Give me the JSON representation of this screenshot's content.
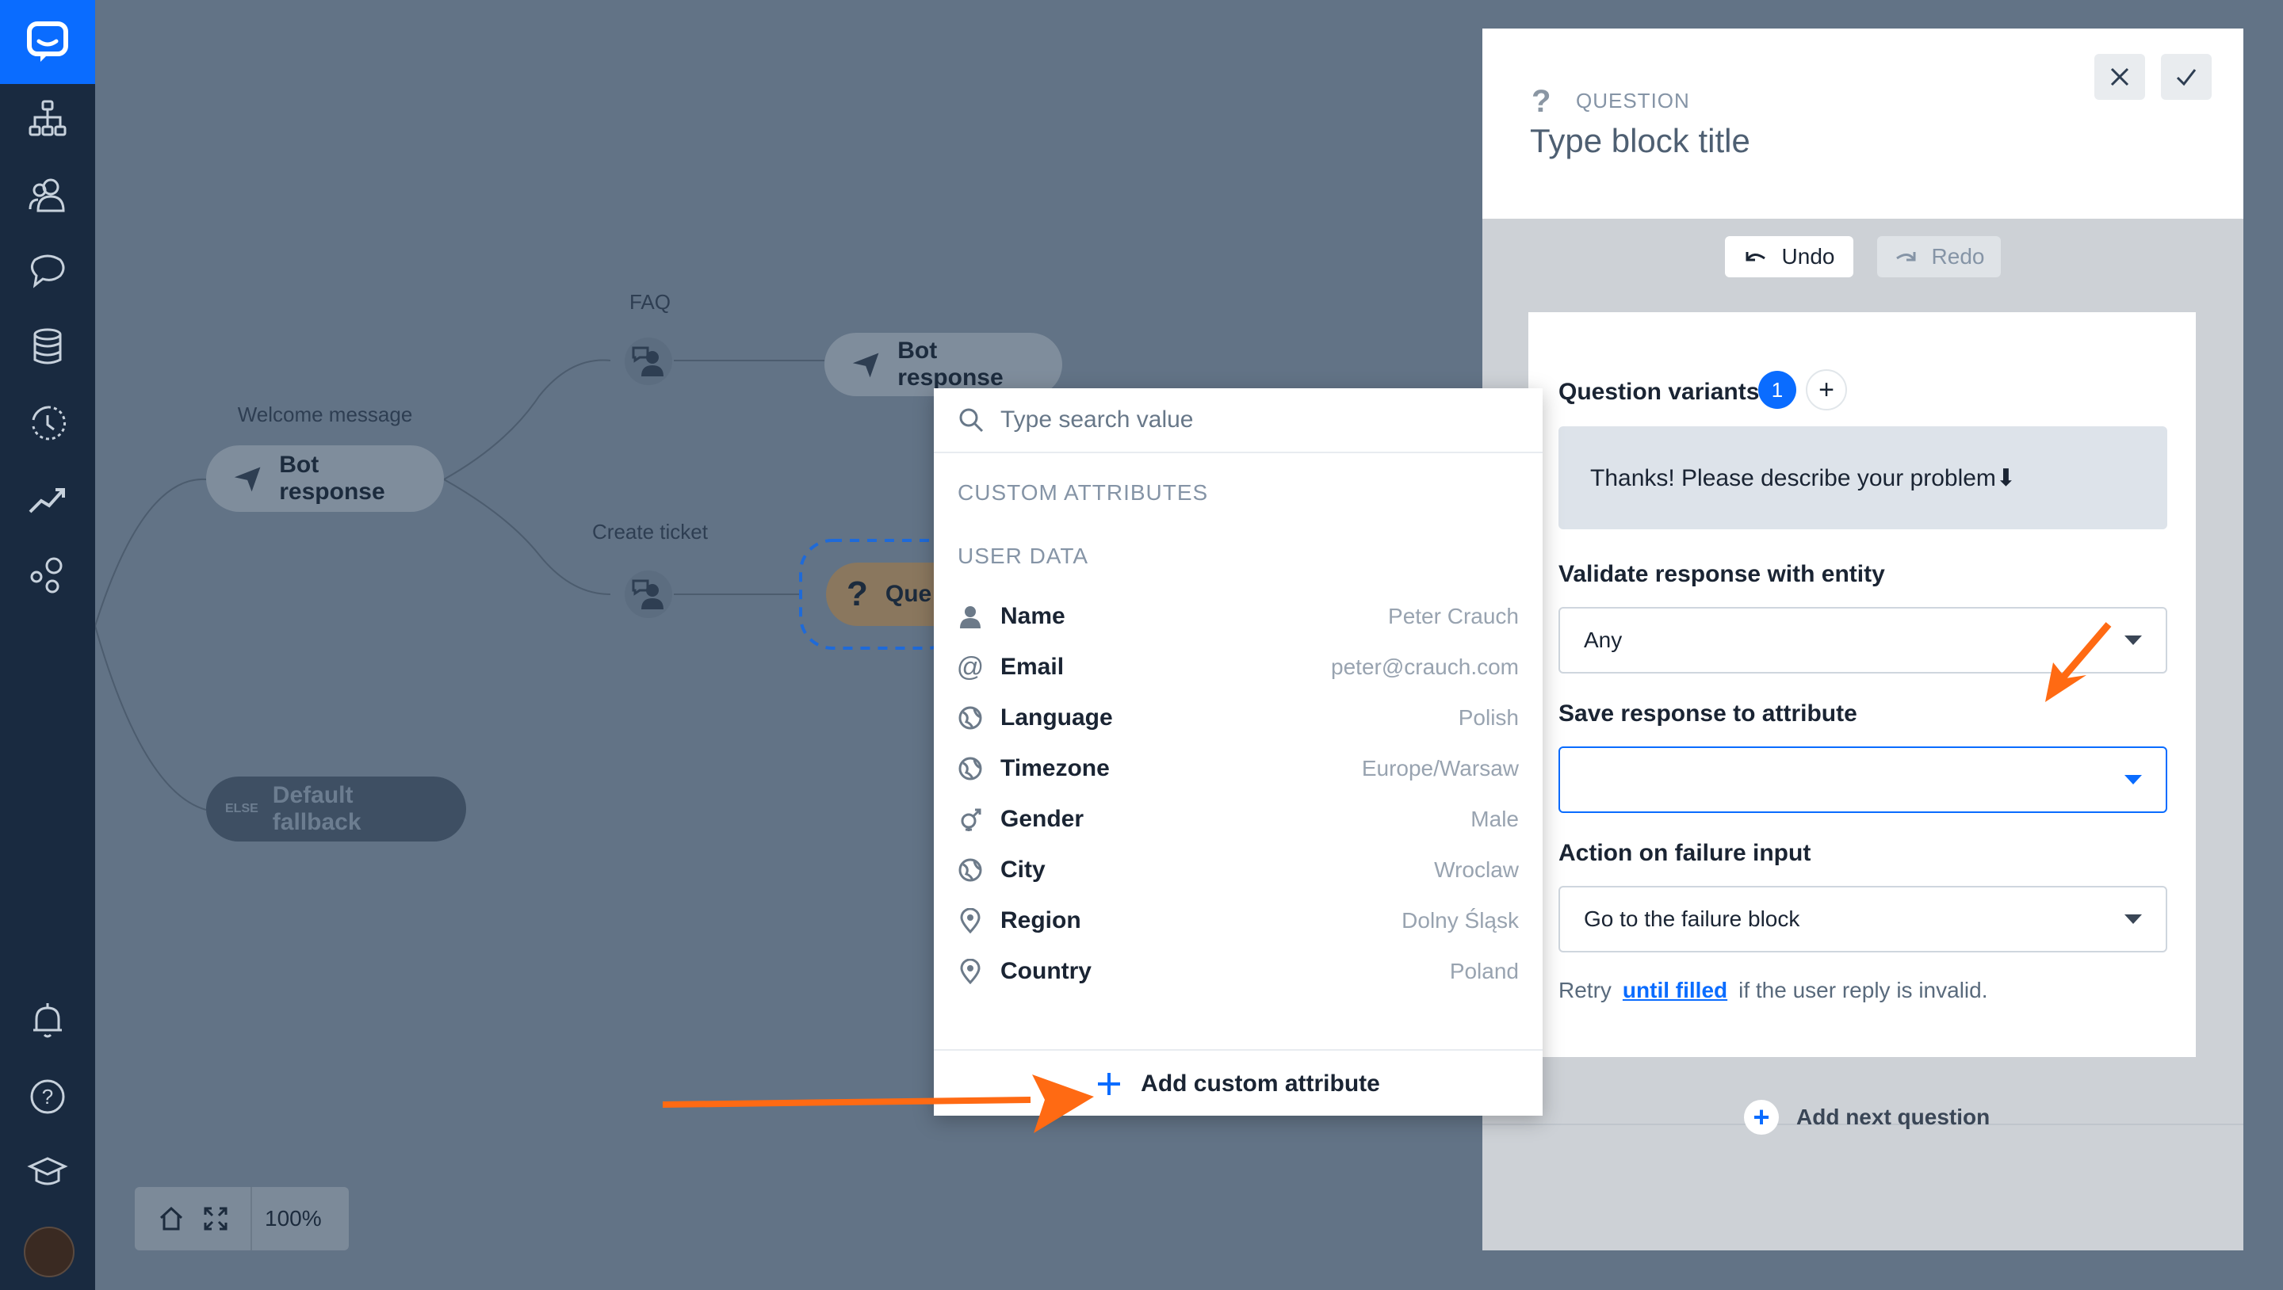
{
  "canvas": {
    "labels": {
      "welcome": "Welcome message",
      "faq": "FAQ",
      "create_ticket": "Create ticket"
    },
    "nodes": {
      "bot_response_1": "Bot response",
      "bot_response_2": "Bot response",
      "question_partial": "Que",
      "else_tag": "ELSE",
      "default_fallback": "Default fallback"
    },
    "zoom": "100%"
  },
  "dropdown": {
    "search_placeholder": "Type search value",
    "custom_attributes_label": "CUSTOM ATTRIBUTES",
    "user_data_label": "USER DATA",
    "items": [
      {
        "label": "Name",
        "value": "Peter Crauch",
        "icon": "person-icon"
      },
      {
        "label": "Email",
        "value": "peter@crauch.com",
        "icon": "at-icon"
      },
      {
        "label": "Language",
        "value": "Polish",
        "icon": "globe-icon"
      },
      {
        "label": "Timezone",
        "value": "Europe/Warsaw",
        "icon": "globe-icon"
      },
      {
        "label": "Gender",
        "value": "Male",
        "icon": "gender-icon"
      },
      {
        "label": "City",
        "value": "Wroclaw",
        "icon": "globe-icon"
      },
      {
        "label": "Region",
        "value": "Dolny Śląsk",
        "icon": "pin-icon"
      },
      {
        "label": "Country",
        "value": "Poland",
        "icon": "pin-icon"
      }
    ],
    "add_custom": "Add custom attribute"
  },
  "panel": {
    "kind": "QUESTION",
    "kind_icon": "?",
    "title": "Type block title",
    "undo": "Undo",
    "redo": "Redo",
    "variants_label": "Question variants",
    "variants_count": "1",
    "variant_text": "Thanks! Please describe your problem⬇",
    "validate_label": "Validate response with entity",
    "validate_value": "Any",
    "save_label": "Save response to attribute",
    "save_value": "",
    "failure_label": "Action on failure input",
    "failure_value": "Go to the failure block",
    "retry_prefix": "Retry",
    "retry_link": "until filled",
    "retry_suffix": "if the user reply is invalid.",
    "add_next": "Add next question"
  },
  "colors": {
    "accent": "#0a6cff",
    "nav_bg": "#192a40",
    "arrow": "#ff6a13"
  }
}
